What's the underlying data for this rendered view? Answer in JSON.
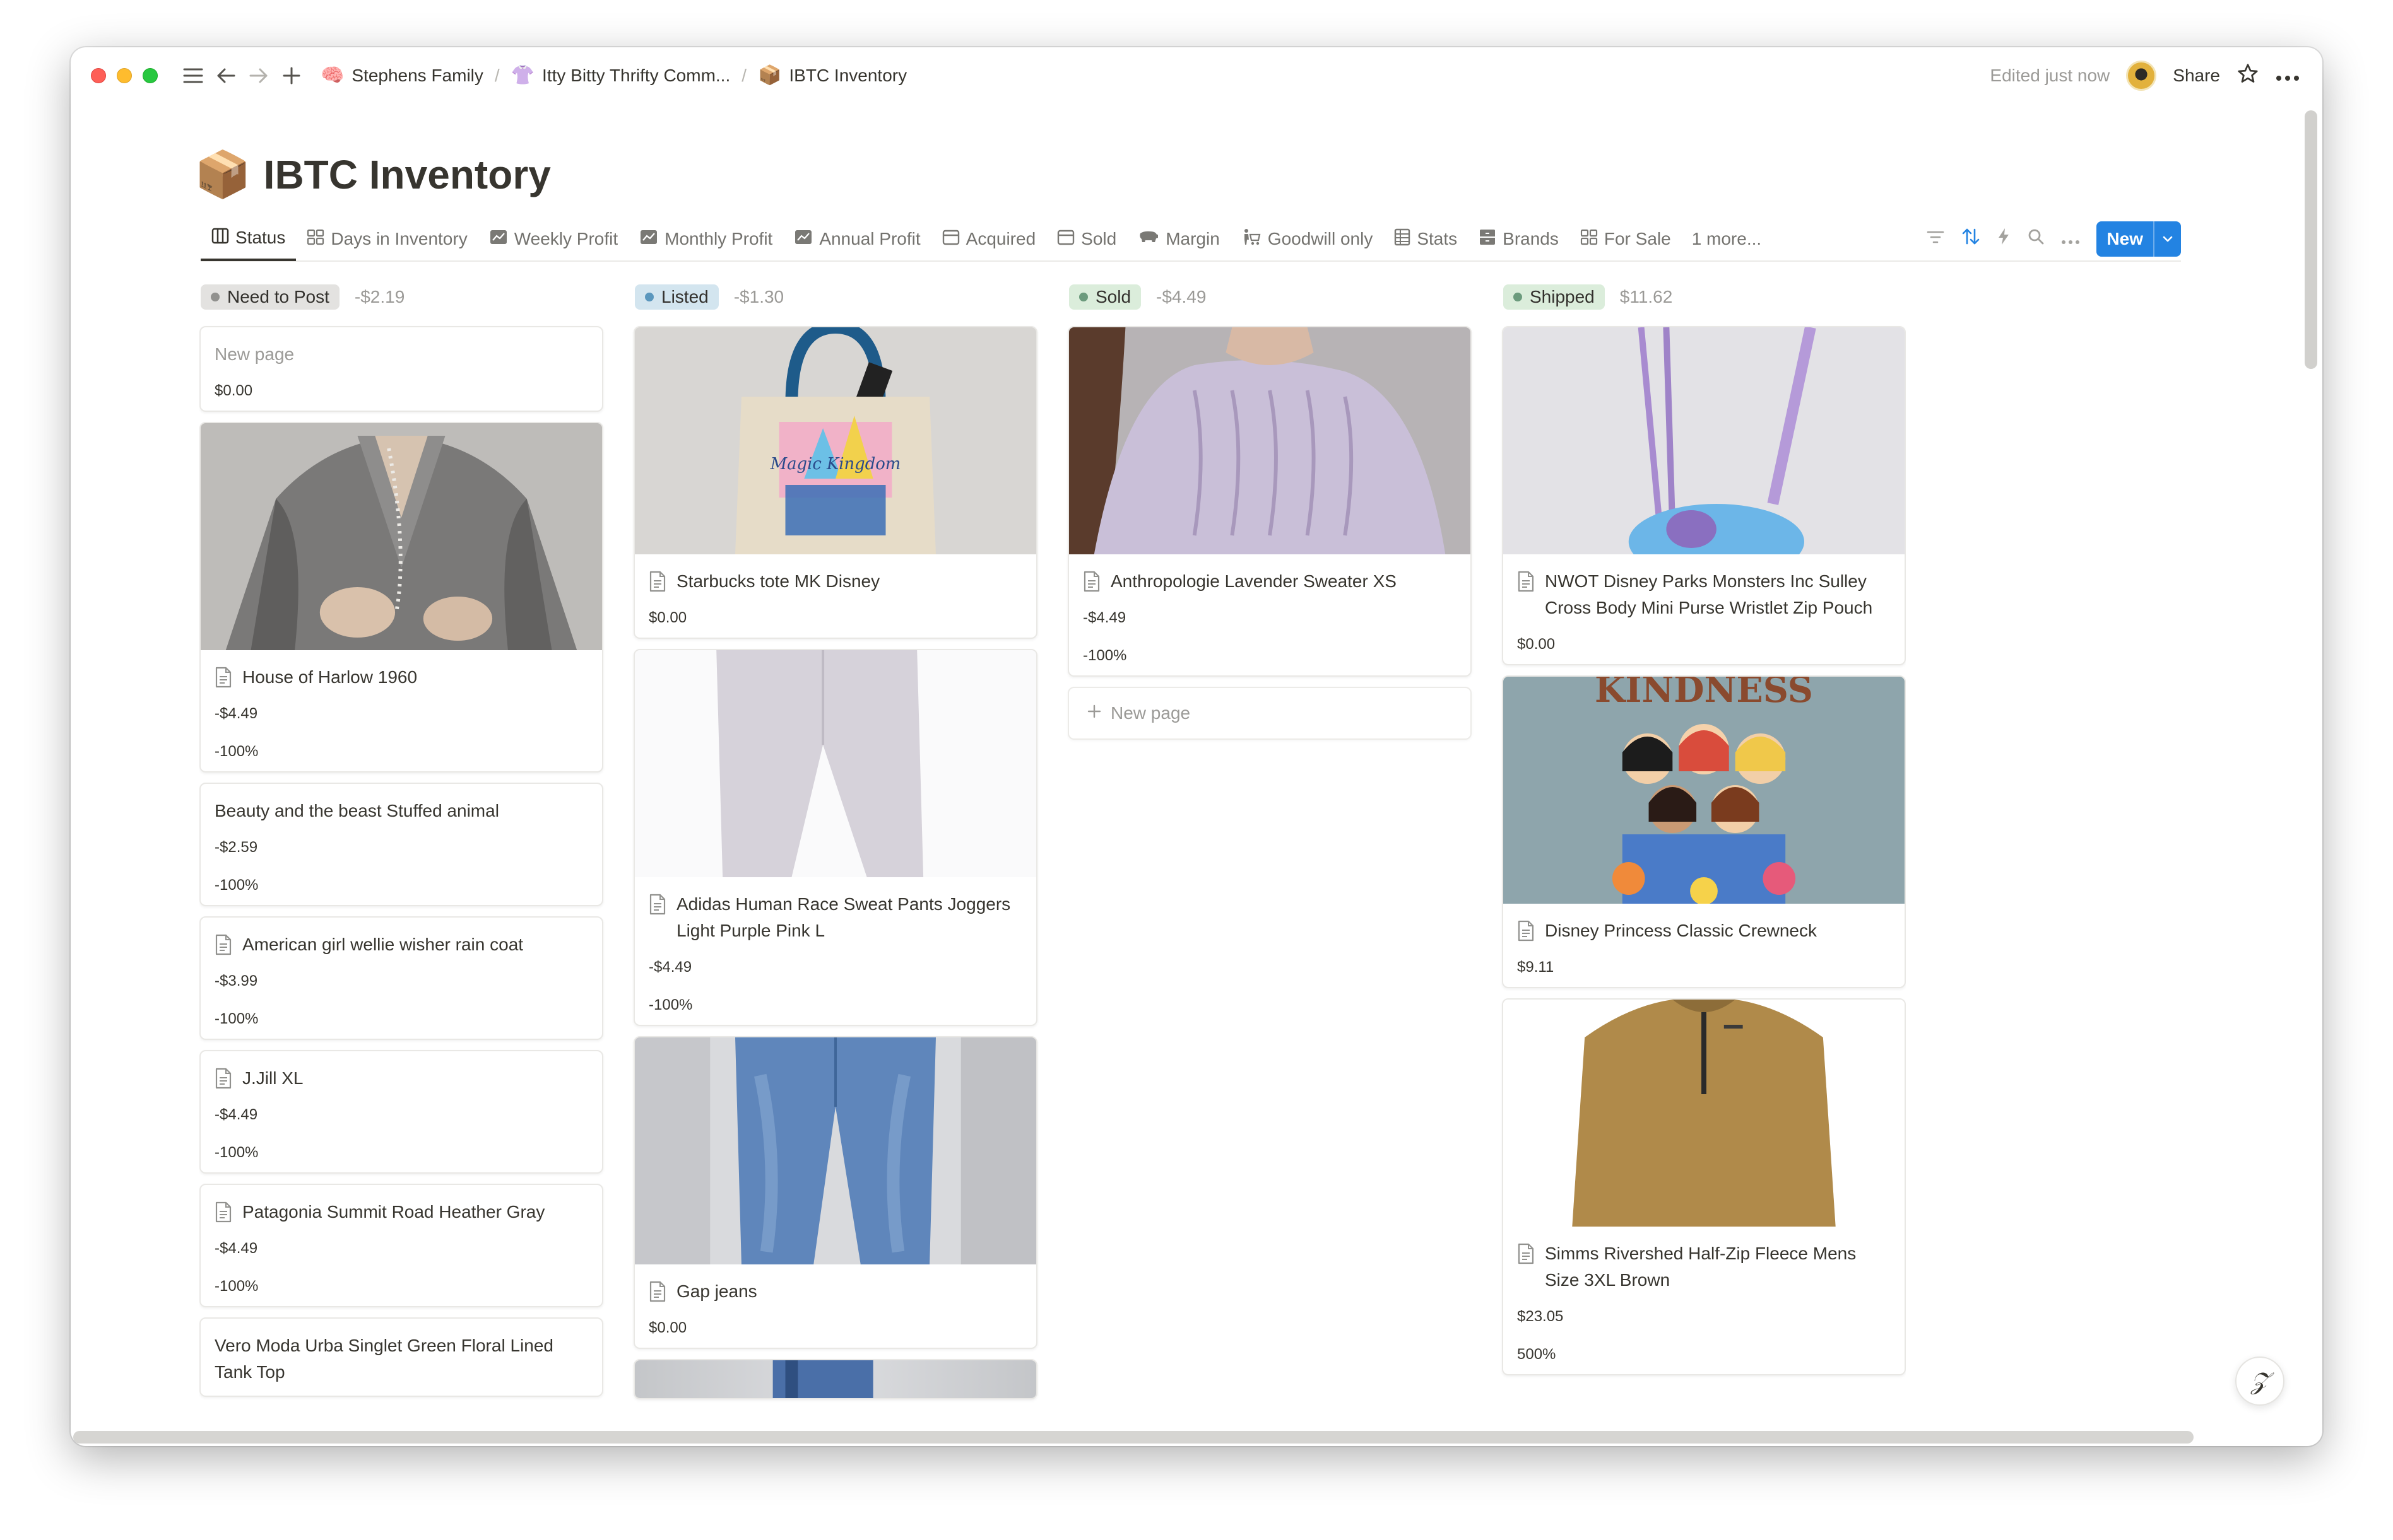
{
  "window": {
    "breadcrumbs": [
      {
        "icon": "🧠",
        "label": "Stephens Family"
      },
      {
        "icon": "👚",
        "label": "Itty Bitty Thrifty Comm..."
      },
      {
        "icon": "📦",
        "label": "IBTC Inventory"
      }
    ],
    "edited": "Edited just now",
    "share": "Share"
  },
  "page": {
    "icon": "📦",
    "title": "IBTC Inventory"
  },
  "views": {
    "tabs": [
      {
        "icon": "board-icon",
        "label": "Status"
      },
      {
        "icon": "gallery-icon",
        "label": "Days in Inventory"
      },
      {
        "icon": "chart-icon",
        "label": "Weekly Profit"
      },
      {
        "icon": "chart-icon",
        "label": "Monthly Profit"
      },
      {
        "icon": "chart-icon",
        "label": "Annual Profit"
      },
      {
        "icon": "calendar-icon",
        "label": "Acquired"
      },
      {
        "icon": "calendar-icon",
        "label": "Sold"
      },
      {
        "icon": "pig-icon",
        "label": "Margin"
      },
      {
        "icon": "person-cart-icon",
        "label": "Goodwill only"
      },
      {
        "icon": "table-icon",
        "label": "Stats"
      },
      {
        "icon": "cabinet-icon",
        "label": "Brands"
      },
      {
        "icon": "gallery-icon",
        "label": "For Sale"
      }
    ],
    "more": "1 more...",
    "new_label": "New"
  },
  "board": {
    "columns": [
      {
        "status": "Need to Post",
        "sum": "-$2.19",
        "pill_bg": "#e3e2e0",
        "dot": "#91918e",
        "cards": [
          {
            "title": "New page",
            "props": [
              "$0.00"
            ],
            "image": null,
            "doc_icon": false,
            "placeholder": true
          },
          {
            "title": "House of Harlow 1960",
            "props": [
              "-$4.49",
              "-100%"
            ],
            "image": "poncho",
            "doc_icon": true
          },
          {
            "title": "Beauty and the beast Stuffed animal",
            "props": [
              "-$2.59",
              "-100%"
            ],
            "image": null,
            "doc_icon": false
          },
          {
            "title": "American girl wellie wisher rain coat",
            "props": [
              "-$3.99",
              "-100%"
            ],
            "image": null,
            "doc_icon": true
          },
          {
            "title": "J.Jill XL",
            "props": [
              "-$4.49",
              "-100%"
            ],
            "image": null,
            "doc_icon": true
          },
          {
            "title": "Patagonia Summit Road Heather Gray",
            "props": [
              "-$4.49",
              "-100%"
            ],
            "image": null,
            "doc_icon": true
          },
          {
            "title": "Vero Moda Urba Singlet Green Floral Lined Tank Top",
            "props": [],
            "image": null,
            "doc_icon": false
          }
        ]
      },
      {
        "status": "Listed",
        "sum": "-$1.30",
        "pill_bg": "#d3e5ef",
        "dot": "#5b97bd",
        "cards": [
          {
            "title": "Starbucks tote MK Disney",
            "props": [
              "$0.00"
            ],
            "image": "tote",
            "doc_icon": true
          },
          {
            "title": "Adidas Human Race Sweat Pants Joggers Light Purple Pink L",
            "props": [
              "-$4.49",
              "-100%"
            ],
            "image": "pants",
            "doc_icon": true
          },
          {
            "title": "Gap jeans",
            "props": [
              "$0.00"
            ],
            "image": "jeans",
            "doc_icon": true
          }
        ]
      },
      {
        "status": "Sold",
        "sum": "-$4.49",
        "pill_bg": "#dbeddb",
        "dot": "#6c9b7d",
        "cards": [
          {
            "title": "Anthropologie Lavender Sweater XS",
            "props": [
              "-$4.49",
              "-100%"
            ],
            "image": "sweater",
            "doc_icon": true
          }
        ],
        "new_page": "New page"
      },
      {
        "status": "Shipped",
        "sum": "$11.62",
        "pill_bg": "#dbeddb",
        "dot": "#6c9b7d",
        "cards": [
          {
            "title": "NWOT Disney Parks Monsters Inc Sulley Cross Body Mini Purse Wristlet Zip Pouch",
            "props": [
              "$0.00"
            ],
            "image": "purse",
            "doc_icon": true
          },
          {
            "title": "Disney Princess Classic Crewneck",
            "props": [
              "$9.11"
            ],
            "image": "crewneck",
            "doc_icon": true
          },
          {
            "title": "Simms Rivershed Half-Zip Fleece Mens Size 3XL Brown",
            "props": [
              "$23.05",
              "500%"
            ],
            "image": "fleece",
            "doc_icon": true
          }
        ]
      }
    ]
  },
  "image_text": {
    "crewneck": "KINDNESS",
    "tote": "Magic Kingdom"
  },
  "colors": {
    "accent": "#2383e2",
    "text": "#37352f",
    "muted": "#9b9a97"
  }
}
